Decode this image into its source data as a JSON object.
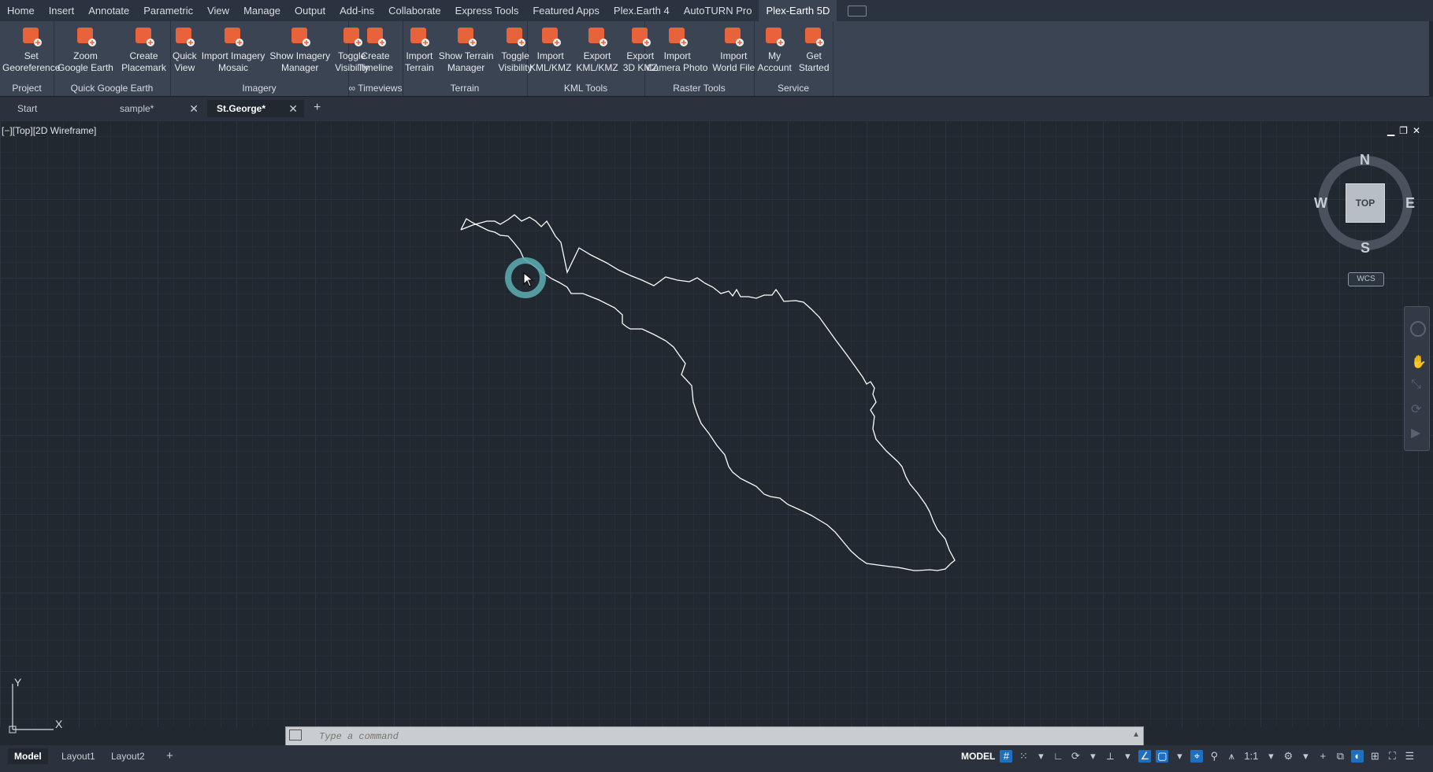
{
  "menu": {
    "tabs": [
      "Home",
      "Insert",
      "Annotate",
      "Parametric",
      "View",
      "Manage",
      "Output",
      "Add-ins",
      "Collaborate",
      "Express Tools",
      "Featured Apps",
      "Plex.Earth 4",
      "AutoTURN Pro",
      "Plex-Earth 5D"
    ],
    "active": "Plex-Earth 5D"
  },
  "ribbon": {
    "panels": [
      {
        "label": "Project",
        "tools": [
          {
            "label": "Set\nGeoreference",
            "icon": "georeference-icon"
          }
        ]
      },
      {
        "label": "Quick Google Earth",
        "tools": [
          {
            "label": "Zoom\nGoogle Earth",
            "icon": "zoom-google-earth-icon"
          },
          {
            "label": "Create\nPlacemark",
            "icon": "placemark-icon"
          }
        ]
      },
      {
        "label": "Imagery",
        "tools": [
          {
            "label": "Quick\nView",
            "icon": "quick-view-icon"
          },
          {
            "label": "Import Imagery\nMosaic",
            "icon": "import-mosaic-icon"
          },
          {
            "label": "Show Imagery\nManager",
            "icon": "imagery-manager-icon"
          },
          {
            "label": "Toggle\nVisibility",
            "icon": "toggle-visibility-icon"
          }
        ]
      },
      {
        "label": "∞ Timeviews",
        "tools": [
          {
            "label": "Create\nTimeline",
            "icon": "timeline-icon"
          }
        ]
      },
      {
        "label": "Terrain",
        "tools": [
          {
            "label": "Import\nTerrain",
            "icon": "import-terrain-icon"
          },
          {
            "label": "Show Terrain\nManager",
            "icon": "terrain-manager-icon"
          },
          {
            "label": "Toggle\nVisibility",
            "icon": "terrain-visibility-icon"
          }
        ]
      },
      {
        "label": "KML Tools",
        "tools": [
          {
            "label": "Import\nKML/KMZ",
            "icon": "import-kml-icon"
          },
          {
            "label": "Export\nKML/KMZ",
            "icon": "export-kml-icon"
          },
          {
            "label": "Export\n3D KMZ",
            "icon": "export-3d-kmz-icon"
          }
        ]
      },
      {
        "label": "Raster Tools",
        "tools": [
          {
            "label": "Import\nCamera Photo",
            "icon": "camera-photo-icon"
          },
          {
            "label": "Import\nWorld File",
            "icon": "world-file-icon"
          }
        ]
      },
      {
        "label": "Service",
        "tools": [
          {
            "label": "My\nAccount",
            "icon": "account-icon"
          },
          {
            "label": "Get\nStarted",
            "icon": "get-started-icon"
          }
        ]
      }
    ]
  },
  "doctabs": [
    {
      "label": "Start",
      "closable": false,
      "active": false
    },
    {
      "label": "sample*",
      "closable": true,
      "active": false
    },
    {
      "label": "St.George*",
      "closable": true,
      "active": true
    }
  ],
  "viewport": {
    "label": "[−][Top][2D Wireframe]",
    "compass": {
      "n": "N",
      "s": "S",
      "e": "E",
      "w": "W",
      "face": "TOP"
    },
    "wcs": "WCS",
    "ucs_x": "X",
    "ucs_y": "Y"
  },
  "command": {
    "placeholder": "Type a command"
  },
  "layouts": [
    "Model",
    "Layout1",
    "Layout2"
  ],
  "status": {
    "model": "MODEL",
    "scale": "1:1"
  },
  "colors": {
    "accent": "#e9633a",
    "active_blue": "#1f6fbf",
    "cursor_ring": "#5aa7ad"
  }
}
